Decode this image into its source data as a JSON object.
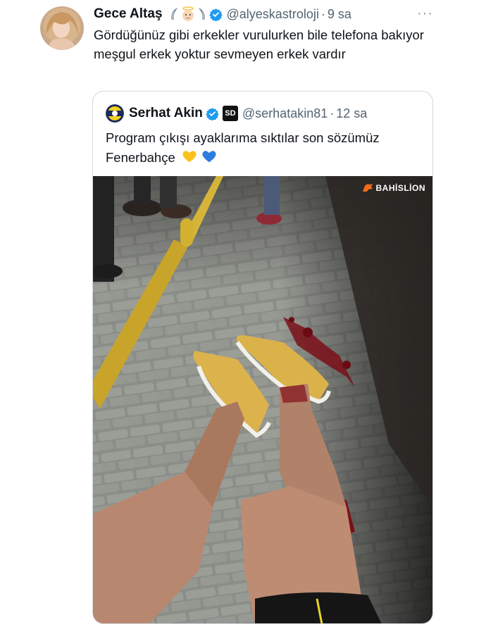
{
  "tweet": {
    "display_name": "Gece Altaş",
    "handle": "@alyeskastroloji",
    "separator": "·",
    "time": "9 sa",
    "more": "···",
    "text": "Gördüğünüz gibi erkekler vurulurken bile telefona bakıyor meşgul erkek yoktur sevmeyen erkek vardır"
  },
  "quote": {
    "display_name": "Serhat Akin",
    "badge": "SD",
    "handle": "@serhatakin81",
    "separator": "·",
    "time": "12 sa",
    "text": "Program çıkışı ayaklarıma sıktılar son sözümüz Fenerbahçe"
  },
  "media": {
    "watermark": "BAHİSLİON"
  },
  "colors": {
    "verified": "#1d9bf0",
    "muted": "#536471",
    "border": "#cfd9de"
  }
}
